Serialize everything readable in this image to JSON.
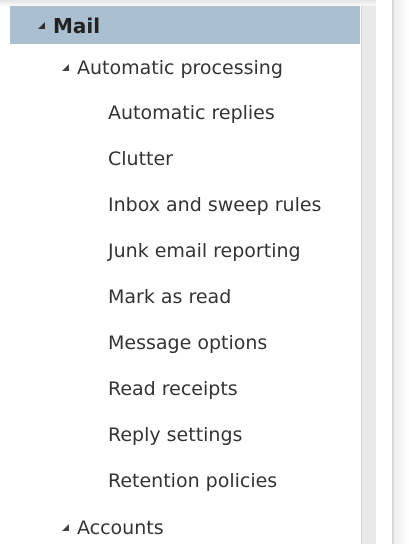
{
  "nav": {
    "mail": {
      "label": "Mail",
      "expanded": true
    },
    "automatic_processing": {
      "label": "Automatic processing",
      "expanded": true,
      "items": [
        "Automatic replies",
        "Clutter",
        "Inbox and sweep rules",
        "Junk email reporting",
        "Mark as read",
        "Message options",
        "Read receipts",
        "Reply settings",
        "Retention policies"
      ]
    },
    "accounts": {
      "label": "Accounts",
      "expanded": true
    }
  },
  "colors": {
    "header_bg": "#aac0d0",
    "text": "#333333",
    "caret": "#444444"
  },
  "icons": {
    "expanded_caret": "triangle-expanded-icon"
  }
}
